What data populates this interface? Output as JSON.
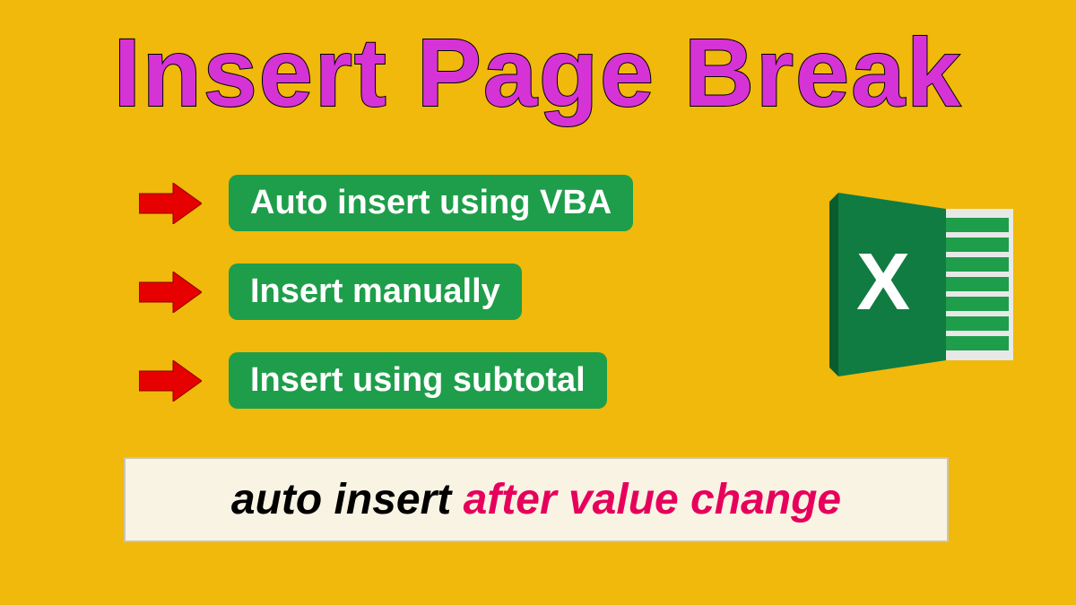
{
  "title": "Insert Page Break",
  "bullets": [
    "Auto insert using VBA",
    "Insert manually",
    "Insert using subtotal"
  ],
  "footer": {
    "part1": "auto insert ",
    "part2": "after value change"
  },
  "colors": {
    "background": "#f0b90b",
    "title": "#d633d6",
    "bulletBg": "#1e9e4a",
    "arrow": "#e60000",
    "footerHighlight": "#e6005c"
  }
}
